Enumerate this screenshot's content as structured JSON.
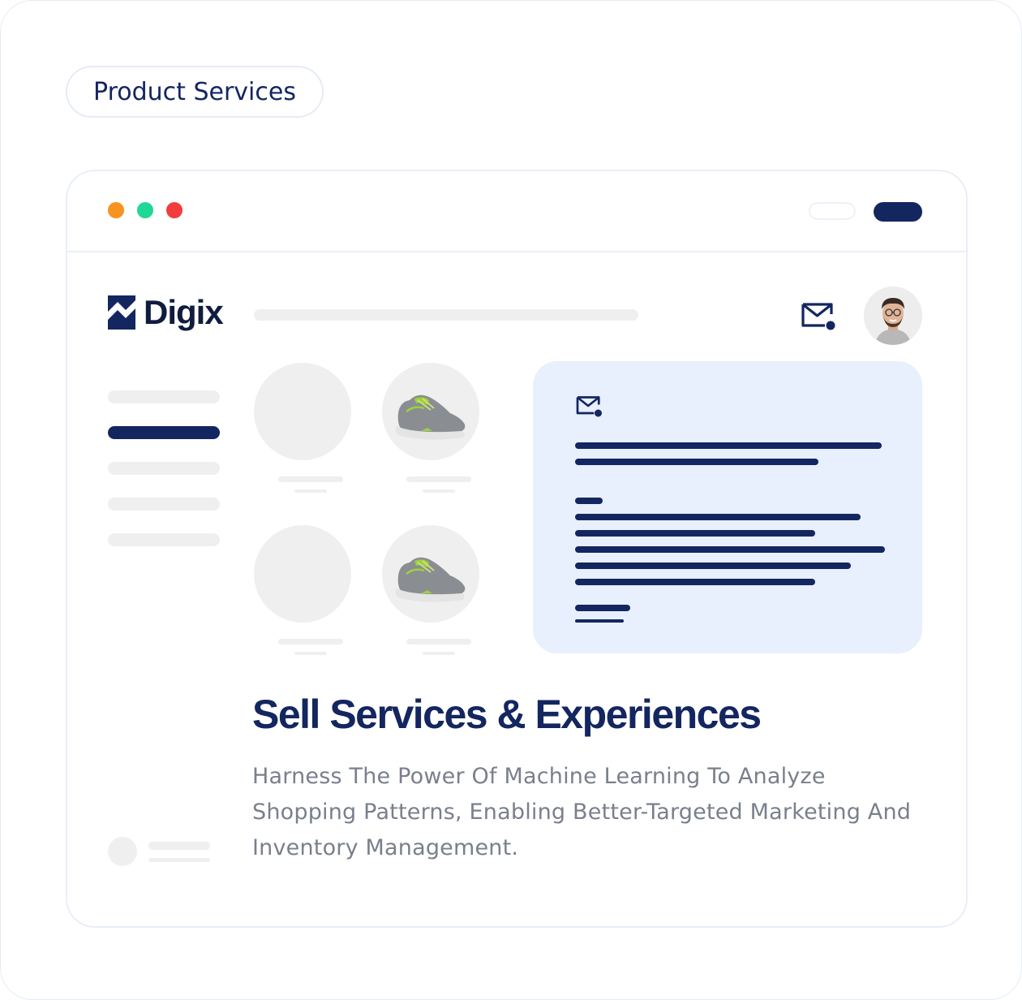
{
  "tag": {
    "label": "Product Services"
  },
  "window": {
    "traffic_lights": [
      {
        "name": "minimize",
        "color": "#f7931e"
      },
      {
        "name": "maximize",
        "color": "#1fd896"
      },
      {
        "name": "close",
        "color": "#f23d3d"
      }
    ]
  },
  "app": {
    "brand": "Digix",
    "accent": "#132660",
    "panel_bg": "#e8effd"
  },
  "header": {
    "mail_icon": "mail-notification-icon",
    "avatar": "user-avatar"
  },
  "products": [
    {
      "image": "empty"
    },
    {
      "image": "sneaker"
    },
    {
      "image": "empty"
    },
    {
      "image": "sneaker"
    }
  ],
  "hero": {
    "title": "Sell Services & Experiences",
    "description": "Harness The Power Of Machine Learning To Analyze Shopping Patterns, Enabling Better-Targeted Marketing And Inventory Management."
  }
}
